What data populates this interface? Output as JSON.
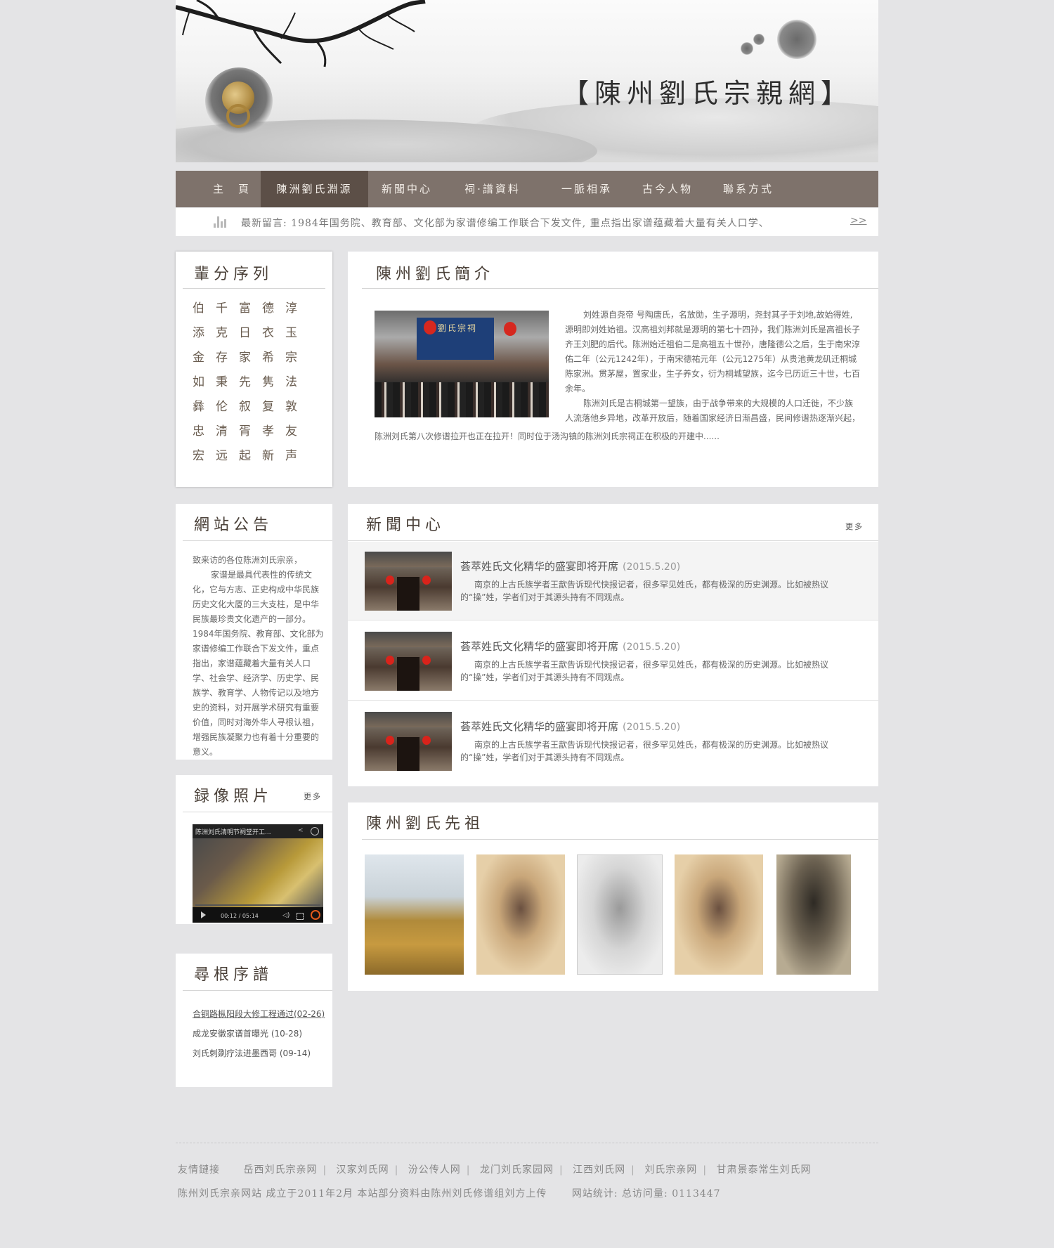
{
  "header": {
    "site_title": "【陳州劉氏宗親網】"
  },
  "nav": {
    "items": [
      "主　頁",
      "陳洲劉氏淵源",
      "新聞中心",
      "祠·譜資料",
      "一脈相承",
      "古今人物",
      "聯系方式"
    ],
    "active_index": 1
  },
  "ticker": {
    "text": "最新留言: 1984年国务院、教育部、文化部为家谱修编工作联合下发文件, 重点指出家谱蕴藏着大量有关人口学、",
    "more": ">>"
  },
  "generation": {
    "title": "輩分序列",
    "rows": [
      [
        "伯",
        "千",
        "富",
        "德",
        "淳"
      ],
      [
        "添",
        "克",
        "日",
        "衣",
        "玉"
      ],
      [
        "金",
        "存",
        "家",
        "希",
        "宗"
      ],
      [
        "如",
        "秉",
        "先",
        "隽",
        "法"
      ],
      [
        "彝",
        "伦",
        "叙",
        "复",
        "敦"
      ],
      [
        "忠",
        "清",
        "胥",
        "孝",
        "友"
      ],
      [
        "宏",
        "远",
        "起",
        "新",
        "声"
      ]
    ]
  },
  "intro": {
    "title": "陳州劉氏簡介",
    "paragraph1": "刘姓源自尧帝 号陶唐氏，名放勋，生子源明，尧封其子于刘地,故始得姓,源明即刘姓始祖。汉高祖刘邦就是源明的第七十四孙，我们陈洲刘氏是高祖长子齐王刘肥的后代。陈洲始迁祖伯二是高祖五十世孙，唐隆德公之后，生于南宋淳佑二年（公元1242年），于南宋德祐元年（公元1275年）从贵池黄龙矶迁桐城陈家洲。贯茅屋，置家业，生子养女，衍为桐城望族，迄今已历近三十世，七百余年。",
    "paragraph2": "陈洲刘氏是古桐城第一望族，由于战争带来的大规模的人口迁徙，不少族人流落他乡异地，改革开放后，随着国家经济日渐昌盛，民间修谱热逐渐兴起，",
    "paragraph3": "陈洲刘氏第八次修谱拉开也正在拉开！同时位于汤沟镇的陈洲刘氏宗祠正在积极的开建中......",
    "photo_sign": "劉氏宗祠"
  },
  "notice": {
    "title": "網站公告",
    "greeting": "致来访的各位陈洲刘氏宗亲，",
    "body": "家谱是最具代表性的传统文化，它与方志、正史构成中华民族历史文化大厦的三大支柱，是中华民族最珍贵文化遗产的一部分。1984年国务院、教育部、文化部为家谱修编工作联合下发文件，重点指出，家谱蕴藏着大量有关人口学、社会学、经济学、历史学、民族学、教育学、人物传记以及地方史的资料，对开展学术研究有重要价值，同时对海外华人寻根认祖，增强民族凝聚力也有着十分重要的意义。"
  },
  "news": {
    "title": "新聞中心",
    "more": "更多",
    "items": [
      {
        "title": "荟萃姓氏文化精华的盛宴即将开席",
        "date": "(2015.5.20)",
        "desc": "南京的上古氏族学者王歆告诉现代快报记者，很多罕见姓氏，都有极深的历史渊源。比如被热议的“操”姓，学者们对于其源头持有不同观点。"
      },
      {
        "title": "荟萃姓氏文化精华的盛宴即将开席",
        "date": "(2015.5.20)",
        "desc": "南京的上古氏族学者王歆告诉现代快报记者，很多罕见姓氏，都有极深的历史渊源。比如被热议的“操”姓，学者们对于其源头持有不同观点。"
      },
      {
        "title": "荟萃姓氏文化精华的盛宴即将开席",
        "date": "(2015.5.20)",
        "desc": "南京的上古氏族学者王歆告诉现代快报记者，很多罕见姓氏，都有极深的历史渊源。比如被热议的“操”姓，学者们对于其源头持有不同观点。"
      }
    ]
  },
  "video": {
    "title": "録像照片",
    "more": "更多",
    "caption": "陈洲刘氏清明节祠堂开工...",
    "time": "00:12 / 05:14"
  },
  "ancestors": {
    "title": "陳州劉氏先祖"
  },
  "roots": {
    "title": "尋根序譜",
    "links": [
      "合铜路枞阳段大修工程通过(02-26)",
      "成龙安徽家谱首曝光 (10-28)",
      "刘氏刺剟疗法进墨西哥 (09-14)"
    ]
  },
  "footer": {
    "links_label": "友情鏈接",
    "links": [
      "岳西刘氏宗亲网",
      "汉家刘氏网",
      "汾公传人网",
      "龙门刘氏家园网",
      "江西刘氏网",
      "刘氏宗亲网",
      "甘肃景泰常生刘氏网"
    ],
    "copyright": "陈州刘氏宗亲网站 成立于2011年2月 本站部分资料由陈州刘氏修谱组刘方上传",
    "stats": "网站统计: 总访问量:  0113447"
  },
  "colors": {
    "page_bg": "#e4e4e6",
    "nav_bg": "#7e726b",
    "nav_active": "#5c4f47",
    "heading": "#4a4038"
  }
}
